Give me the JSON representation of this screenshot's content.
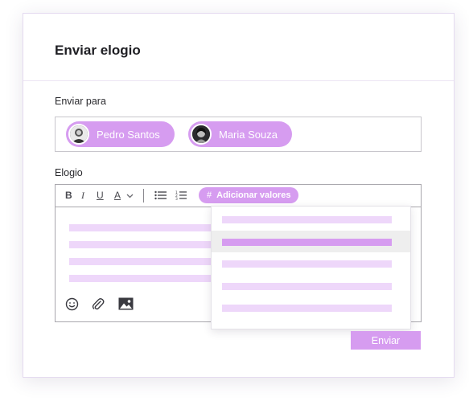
{
  "dialog": {
    "title": "Enviar elogio",
    "recipients_label": "Enviar para",
    "recipients": [
      {
        "name": "Pedro Santos"
      },
      {
        "name": "Maria Souza"
      }
    ],
    "message_label": "Elogio",
    "send_label": "Enviar"
  },
  "toolbar": {
    "bold": "B",
    "italic": "I",
    "underline": "U",
    "text_color": "A",
    "add_values_hash": "#",
    "add_values_label": "Adicionar valores"
  },
  "values_dropdown": {
    "item_count": 5,
    "selected_index": 1
  },
  "colors": {
    "accent": "#d69cf0",
    "placeholder_line": "#eed7fa",
    "selected_row": "#eeeeee"
  },
  "icons": {
    "toolbar": [
      "bold-icon",
      "italic-icon",
      "underline-icon",
      "text-color-icon",
      "chevron-down-icon",
      "bullet-list-icon",
      "numbered-list-icon",
      "hash-icon"
    ],
    "footer": [
      "emoji-icon",
      "paperclip-icon",
      "image-icon"
    ]
  }
}
